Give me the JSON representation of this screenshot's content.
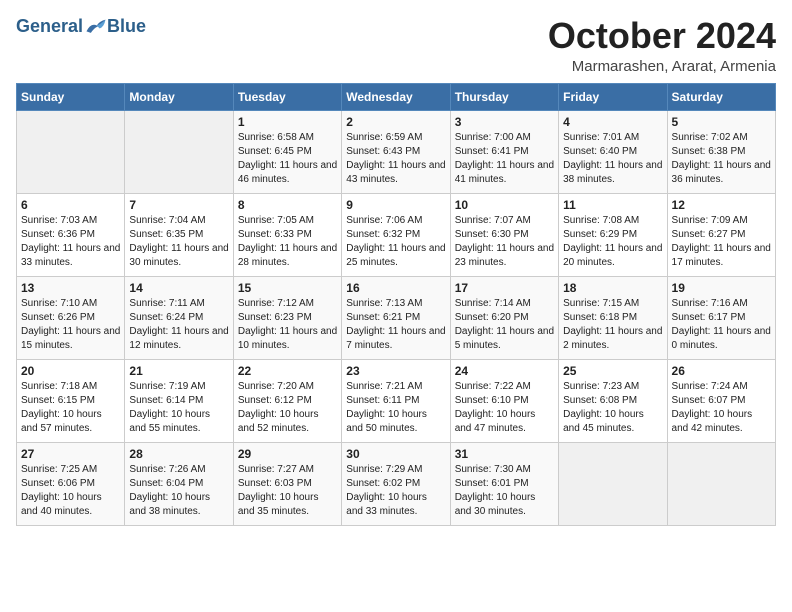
{
  "header": {
    "logo_general": "General",
    "logo_blue": "Blue",
    "month_title": "October 2024",
    "location": "Marmarashen, Ararat, Armenia"
  },
  "weekdays": [
    "Sunday",
    "Monday",
    "Tuesday",
    "Wednesday",
    "Thursday",
    "Friday",
    "Saturday"
  ],
  "weeks": [
    [
      {
        "day": "",
        "sunrise": "",
        "sunset": "",
        "daylight": ""
      },
      {
        "day": "",
        "sunrise": "",
        "sunset": "",
        "daylight": ""
      },
      {
        "day": "1",
        "sunrise": "Sunrise: 6:58 AM",
        "sunset": "Sunset: 6:45 PM",
        "daylight": "Daylight: 11 hours and 46 minutes."
      },
      {
        "day": "2",
        "sunrise": "Sunrise: 6:59 AM",
        "sunset": "Sunset: 6:43 PM",
        "daylight": "Daylight: 11 hours and 43 minutes."
      },
      {
        "day": "3",
        "sunrise": "Sunrise: 7:00 AM",
        "sunset": "Sunset: 6:41 PM",
        "daylight": "Daylight: 11 hours and 41 minutes."
      },
      {
        "day": "4",
        "sunrise": "Sunrise: 7:01 AM",
        "sunset": "Sunset: 6:40 PM",
        "daylight": "Daylight: 11 hours and 38 minutes."
      },
      {
        "day": "5",
        "sunrise": "Sunrise: 7:02 AM",
        "sunset": "Sunset: 6:38 PM",
        "daylight": "Daylight: 11 hours and 36 minutes."
      }
    ],
    [
      {
        "day": "6",
        "sunrise": "Sunrise: 7:03 AM",
        "sunset": "Sunset: 6:36 PM",
        "daylight": "Daylight: 11 hours and 33 minutes."
      },
      {
        "day": "7",
        "sunrise": "Sunrise: 7:04 AM",
        "sunset": "Sunset: 6:35 PM",
        "daylight": "Daylight: 11 hours and 30 minutes."
      },
      {
        "day": "8",
        "sunrise": "Sunrise: 7:05 AM",
        "sunset": "Sunset: 6:33 PM",
        "daylight": "Daylight: 11 hours and 28 minutes."
      },
      {
        "day": "9",
        "sunrise": "Sunrise: 7:06 AM",
        "sunset": "Sunset: 6:32 PM",
        "daylight": "Daylight: 11 hours and 25 minutes."
      },
      {
        "day": "10",
        "sunrise": "Sunrise: 7:07 AM",
        "sunset": "Sunset: 6:30 PM",
        "daylight": "Daylight: 11 hours and 23 minutes."
      },
      {
        "day": "11",
        "sunrise": "Sunrise: 7:08 AM",
        "sunset": "Sunset: 6:29 PM",
        "daylight": "Daylight: 11 hours and 20 minutes."
      },
      {
        "day": "12",
        "sunrise": "Sunrise: 7:09 AM",
        "sunset": "Sunset: 6:27 PM",
        "daylight": "Daylight: 11 hours and 17 minutes."
      }
    ],
    [
      {
        "day": "13",
        "sunrise": "Sunrise: 7:10 AM",
        "sunset": "Sunset: 6:26 PM",
        "daylight": "Daylight: 11 hours and 15 minutes."
      },
      {
        "day": "14",
        "sunrise": "Sunrise: 7:11 AM",
        "sunset": "Sunset: 6:24 PM",
        "daylight": "Daylight: 11 hours and 12 minutes."
      },
      {
        "day": "15",
        "sunrise": "Sunrise: 7:12 AM",
        "sunset": "Sunset: 6:23 PM",
        "daylight": "Daylight: 11 hours and 10 minutes."
      },
      {
        "day": "16",
        "sunrise": "Sunrise: 7:13 AM",
        "sunset": "Sunset: 6:21 PM",
        "daylight": "Daylight: 11 hours and 7 minutes."
      },
      {
        "day": "17",
        "sunrise": "Sunrise: 7:14 AM",
        "sunset": "Sunset: 6:20 PM",
        "daylight": "Daylight: 11 hours and 5 minutes."
      },
      {
        "day": "18",
        "sunrise": "Sunrise: 7:15 AM",
        "sunset": "Sunset: 6:18 PM",
        "daylight": "Daylight: 11 hours and 2 minutes."
      },
      {
        "day": "19",
        "sunrise": "Sunrise: 7:16 AM",
        "sunset": "Sunset: 6:17 PM",
        "daylight": "Daylight: 11 hours and 0 minutes."
      }
    ],
    [
      {
        "day": "20",
        "sunrise": "Sunrise: 7:18 AM",
        "sunset": "Sunset: 6:15 PM",
        "daylight": "Daylight: 10 hours and 57 minutes."
      },
      {
        "day": "21",
        "sunrise": "Sunrise: 7:19 AM",
        "sunset": "Sunset: 6:14 PM",
        "daylight": "Daylight: 10 hours and 55 minutes."
      },
      {
        "day": "22",
        "sunrise": "Sunrise: 7:20 AM",
        "sunset": "Sunset: 6:12 PM",
        "daylight": "Daylight: 10 hours and 52 minutes."
      },
      {
        "day": "23",
        "sunrise": "Sunrise: 7:21 AM",
        "sunset": "Sunset: 6:11 PM",
        "daylight": "Daylight: 10 hours and 50 minutes."
      },
      {
        "day": "24",
        "sunrise": "Sunrise: 7:22 AM",
        "sunset": "Sunset: 6:10 PM",
        "daylight": "Daylight: 10 hours and 47 minutes."
      },
      {
        "day": "25",
        "sunrise": "Sunrise: 7:23 AM",
        "sunset": "Sunset: 6:08 PM",
        "daylight": "Daylight: 10 hours and 45 minutes."
      },
      {
        "day": "26",
        "sunrise": "Sunrise: 7:24 AM",
        "sunset": "Sunset: 6:07 PM",
        "daylight": "Daylight: 10 hours and 42 minutes."
      }
    ],
    [
      {
        "day": "27",
        "sunrise": "Sunrise: 7:25 AM",
        "sunset": "Sunset: 6:06 PM",
        "daylight": "Daylight: 10 hours and 40 minutes."
      },
      {
        "day": "28",
        "sunrise": "Sunrise: 7:26 AM",
        "sunset": "Sunset: 6:04 PM",
        "daylight": "Daylight: 10 hours and 38 minutes."
      },
      {
        "day": "29",
        "sunrise": "Sunrise: 7:27 AM",
        "sunset": "Sunset: 6:03 PM",
        "daylight": "Daylight: 10 hours and 35 minutes."
      },
      {
        "day": "30",
        "sunrise": "Sunrise: 7:29 AM",
        "sunset": "Sunset: 6:02 PM",
        "daylight": "Daylight: 10 hours and 33 minutes."
      },
      {
        "day": "31",
        "sunrise": "Sunrise: 7:30 AM",
        "sunset": "Sunset: 6:01 PM",
        "daylight": "Daylight: 10 hours and 30 minutes."
      },
      {
        "day": "",
        "sunrise": "",
        "sunset": "",
        "daylight": ""
      },
      {
        "day": "",
        "sunrise": "",
        "sunset": "",
        "daylight": ""
      }
    ]
  ]
}
